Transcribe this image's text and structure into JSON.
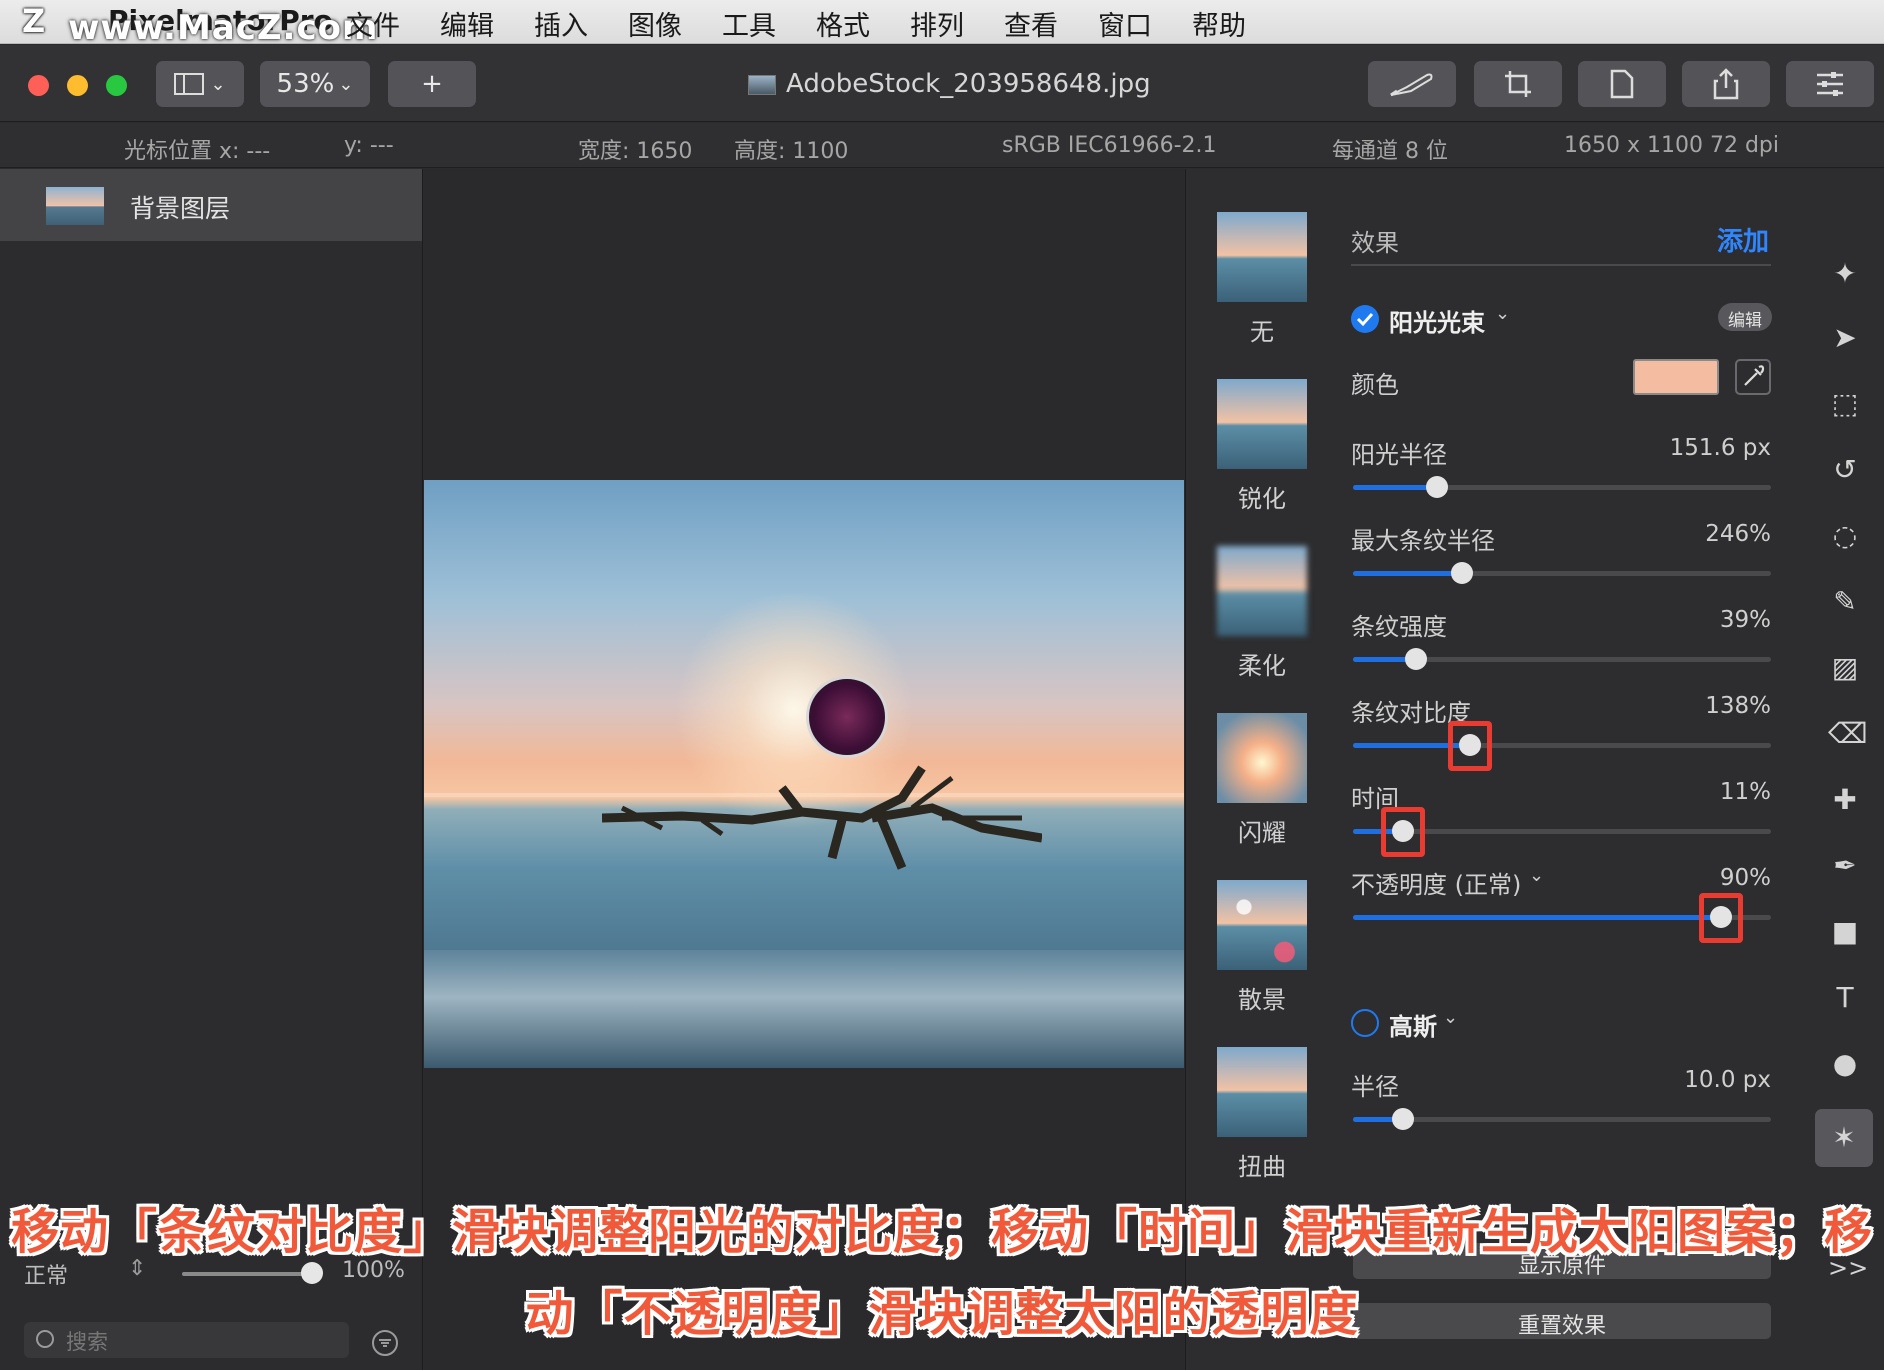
{
  "menubar": {
    "app_name": "PixelmatorPro",
    "watermark": "www.MacZ.com",
    "logo": "Z",
    "items": [
      "文件",
      "编辑",
      "插入",
      "图像",
      "工具",
      "格式",
      "排列",
      "查看",
      "窗口",
      "帮助"
    ]
  },
  "toolbar": {
    "zoom": "53%",
    "add_label": "+",
    "document_title": "AdobeStock_203958648.jpg"
  },
  "infobar": {
    "cursor_x": "光标位置 x: ---",
    "cursor_y": "y: ---",
    "width": "宽度: 1650",
    "height": "高度: 1100",
    "color_profile": "sRGB IEC61966-2.1",
    "bit_depth": "每通道 8 位",
    "dimensions": "1650 x 1100 72 dpi"
  },
  "layers": {
    "layer_name": "背景图层",
    "blend_mode": "正常",
    "opacity": "100%",
    "opacity_fraction": 1.0,
    "search_placeholder": "搜索"
  },
  "effects_list": [
    "无",
    "锐化",
    "柔化",
    "闪耀",
    "散景",
    "扭曲"
  ],
  "settings": {
    "section_title": "效果",
    "add_label": "添加",
    "effect1": {
      "name": "阳光光束",
      "edit_label": "编辑",
      "color_label": "颜色",
      "color": "#f4bda1",
      "sliders": [
        {
          "label": "阳光半径",
          "value": "151.6 px",
          "fraction": 0.2
        },
        {
          "label": "最大条纹半径",
          "value": "246%",
          "fraction": 0.26
        },
        {
          "label": "条纹强度",
          "value": "39%",
          "fraction": 0.15
        },
        {
          "label": "条纹对比度",
          "value": "138%",
          "fraction": 0.28
        },
        {
          "label": "时间",
          "value": "11%",
          "fraction": 0.12
        },
        {
          "label": "不透明度 (正常)",
          "value": "90%",
          "fraction": 0.88
        }
      ]
    },
    "effect2": {
      "name": "高斯",
      "radius_label": "半径",
      "radius_value": "10.0 px",
      "radius_fraction": 0.12
    },
    "show_original": "显示原件",
    "reset_effects": "重置效果",
    "more_label": ">>"
  },
  "caption": {
    "line1": "移动「条纹对比度」滑块调整阳光的对比度；移动「时间」滑块重新生成太阳图案；移",
    "line2": "动「不透明度」滑块调整太阳的透明度"
  }
}
